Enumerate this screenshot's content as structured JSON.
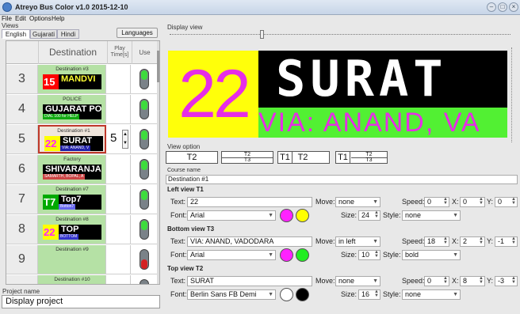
{
  "window": {
    "title": "Atreyo Bus Color v1.0 2015-12-10"
  },
  "menu": [
    "File",
    "Edit",
    "Options",
    "Help"
  ],
  "views": {
    "label": "Views",
    "tabs": [
      "English",
      "Gujarati",
      "Hindi"
    ],
    "languages_button": "Languages"
  },
  "grid": {
    "headers": {
      "destination": "Destination",
      "play": "Play Time[s]",
      "use": "Use"
    },
    "rows": [
      {
        "num": "3",
        "name": "Destination #3",
        "lead": "15",
        "top": "MANDVI",
        "sub": "",
        "play": "",
        "use": "on"
      },
      {
        "num": "4",
        "name": "POLICE",
        "lead": "",
        "top": "GUJARAT POLICE",
        "sub": "DIAL 100 for HELP",
        "play": "",
        "use": "on"
      },
      {
        "num": "5",
        "name": "Destination #1",
        "lead": "22",
        "top": "SURAT",
        "sub": "VIA: ANAND, V",
        "play": "5",
        "use": "on"
      },
      {
        "num": "6",
        "name": "Factory",
        "lead": "",
        "top": "SHIVARANJANI",
        "sub": "SAMARTH, BOPAL, A",
        "play": "",
        "use": "on"
      },
      {
        "num": "7",
        "name": "Destination #7",
        "lead": "T7",
        "top": "Top7",
        "sub": "Botton7",
        "play": "",
        "use": "on"
      },
      {
        "num": "8",
        "name": "Destination #8",
        "lead": "22",
        "top": "TOP",
        "sub": "BOTTOM",
        "play": "",
        "use": "on"
      },
      {
        "num": "9",
        "name": "Destination #9",
        "lead": "",
        "top": "",
        "sub": "",
        "play": "",
        "use": "off"
      },
      {
        "num": "",
        "name": "Destination #10",
        "lead": "",
        "top": "",
        "sub": "",
        "play": "",
        "use": "off"
      }
    ]
  },
  "project": {
    "label": "Project name",
    "value": "Display project"
  },
  "display": {
    "label": "Display view",
    "left": "22",
    "top": "SURAT",
    "bottom": "VIA: ANAND, VA"
  },
  "view_option": {
    "label": "View option",
    "opt1": "T2",
    "opt2_top": "T2",
    "opt2_bottom": "T3",
    "opt3_left": "T1",
    "opt3_right": "T2",
    "opt4_left": "T1",
    "opt4_top": "T2",
    "opt4_bottom": "T3"
  },
  "course": {
    "label": "Course name",
    "value": "Destination #1"
  },
  "sections": [
    {
      "title": "Left view T1",
      "text": "22",
      "move": "none",
      "speed": "0",
      "x": "0",
      "y": "0",
      "font": "Arial",
      "size": "24",
      "style": "none",
      "color1": "#ff22ff",
      "color2": "#ffff00"
    },
    {
      "title": "Bottom view T3",
      "text": "VIA: ANAND, VADODARA",
      "move": "in left",
      "speed": "18",
      "x": "2",
      "y": "-1",
      "font": "Arial",
      "size": "10",
      "style": "bold",
      "color1": "#ff22ff",
      "color2": "#22ee22"
    },
    {
      "title": "Top view T2",
      "text": "SURAT",
      "move": "none",
      "speed": "0",
      "x": "8",
      "y": "-3",
      "font": "Berlin Sans FB Demi",
      "size": "16",
      "style": "none",
      "color1": "#ffffff",
      "color2": "#000000"
    }
  ],
  "field_labels": {
    "text": "Text:",
    "move": "Move:",
    "speed": "Speed:",
    "x": "X:",
    "y": "Y:",
    "font": "Font:",
    "size": "Size:",
    "style": "Style:"
  }
}
